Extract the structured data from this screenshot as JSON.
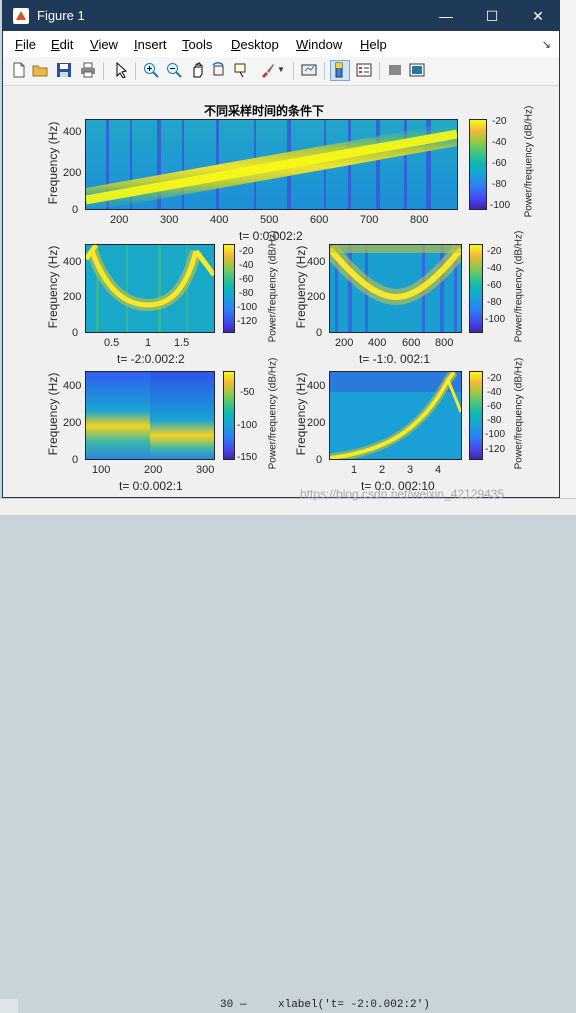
{
  "window": {
    "title": "Figure 1",
    "controls": {
      "minimize": "—",
      "maximize": "☐",
      "close": "✕"
    }
  },
  "menu": {
    "items": [
      {
        "key": "F",
        "rest": "ile"
      },
      {
        "key": "E",
        "rest": "dit"
      },
      {
        "key": "V",
        "rest": "iew"
      },
      {
        "key": "I",
        "rest": "nsert"
      },
      {
        "key": "T",
        "rest": "ools"
      },
      {
        "key": "D",
        "rest": "esktop"
      },
      {
        "key": "W",
        "rest": "indow"
      },
      {
        "key": "H",
        "rest": "elp"
      }
    ],
    "dock_arrow": "↘"
  },
  "toolbar": {
    "icons": [
      "new-figure-icon",
      "open-icon",
      "save-icon",
      "print-icon",
      "pointer-icon",
      "zoom-in-icon",
      "zoom-out-icon",
      "pan-icon",
      "rotate-3d-icon",
      "data-cursor-icon",
      "brush-icon",
      "link-plot-icon",
      "colorbar-icon",
      "legend-icon",
      "hide-plot-tools-icon",
      "show-plot-tools-icon"
    ]
  },
  "background": {
    "code_line_num": "30",
    "code_dash": "—",
    "code_text": "xlabel('t= -2:0.002:2')",
    "watermark": "https://blog.csdn.net/weixin_42129435"
  },
  "plots": [
    {
      "id": "top",
      "title": "不同采样时间的条件下",
      "xlabel": "t= 0:0.002:2",
      "ylabel": "Frequency (Hz)",
      "xticks": [
        "200",
        "300",
        "400",
        "500",
        "600",
        "700",
        "800"
      ],
      "yticks": [
        "400",
        "200",
        "0"
      ],
      "colorbar": {
        "ticks": [
          "-20",
          "-40",
          "-60",
          "-80",
          "-100"
        ],
        "label": "Power/frequency (dB/Hz)"
      }
    },
    {
      "id": "mid-left",
      "xlabel": "t= -2:0.002:2",
      "ylabel": "Frequency (Hz)",
      "xticks": [
        "0.5",
        "1",
        "1.5"
      ],
      "yticks": [
        "400",
        "200",
        "0"
      ],
      "colorbar": {
        "ticks": [
          "-20",
          "-40",
          "-60",
          "-80",
          "-100",
          "-120"
        ],
        "label": "Power/frequency (dB/Hz)"
      }
    },
    {
      "id": "mid-right",
      "xlabel": "t= -1:0. 002:1",
      "ylabel": "Frequency (Hz)",
      "xticks": [
        "200",
        "400",
        "600",
        "800"
      ],
      "yticks": [
        "400",
        "200",
        "0"
      ],
      "colorbar": {
        "ticks": [
          "-20",
          "-40",
          "-60",
          "-80",
          "-100"
        ],
        "label": "Power/frequency (dB/Hz)"
      }
    },
    {
      "id": "bottom-left",
      "xlabel": "t= 0:0.002:1",
      "ylabel": "Frequency (Hz)",
      "xticks": [
        "100",
        "200",
        "300"
      ],
      "yticks": [
        "400",
        "200",
        "0"
      ],
      "colorbar": {
        "ticks": [
          "-50",
          "-100",
          "-150"
        ],
        "label": "Power/frequency (dB/Hz)"
      }
    },
    {
      "id": "bottom-right",
      "xlabel": "t= 0:0. 002:10",
      "ylabel": "Frequency (Hz)",
      "xticks": [
        "1",
        "2",
        "3",
        "4"
      ],
      "yticks": [
        "400",
        "200",
        "0"
      ],
      "colorbar": {
        "ticks": [
          "-20",
          "-40",
          "-60",
          "-80",
          "-100",
          "-120"
        ],
        "label": "Power/frequency (dB/Hz)"
      }
    }
  ]
}
